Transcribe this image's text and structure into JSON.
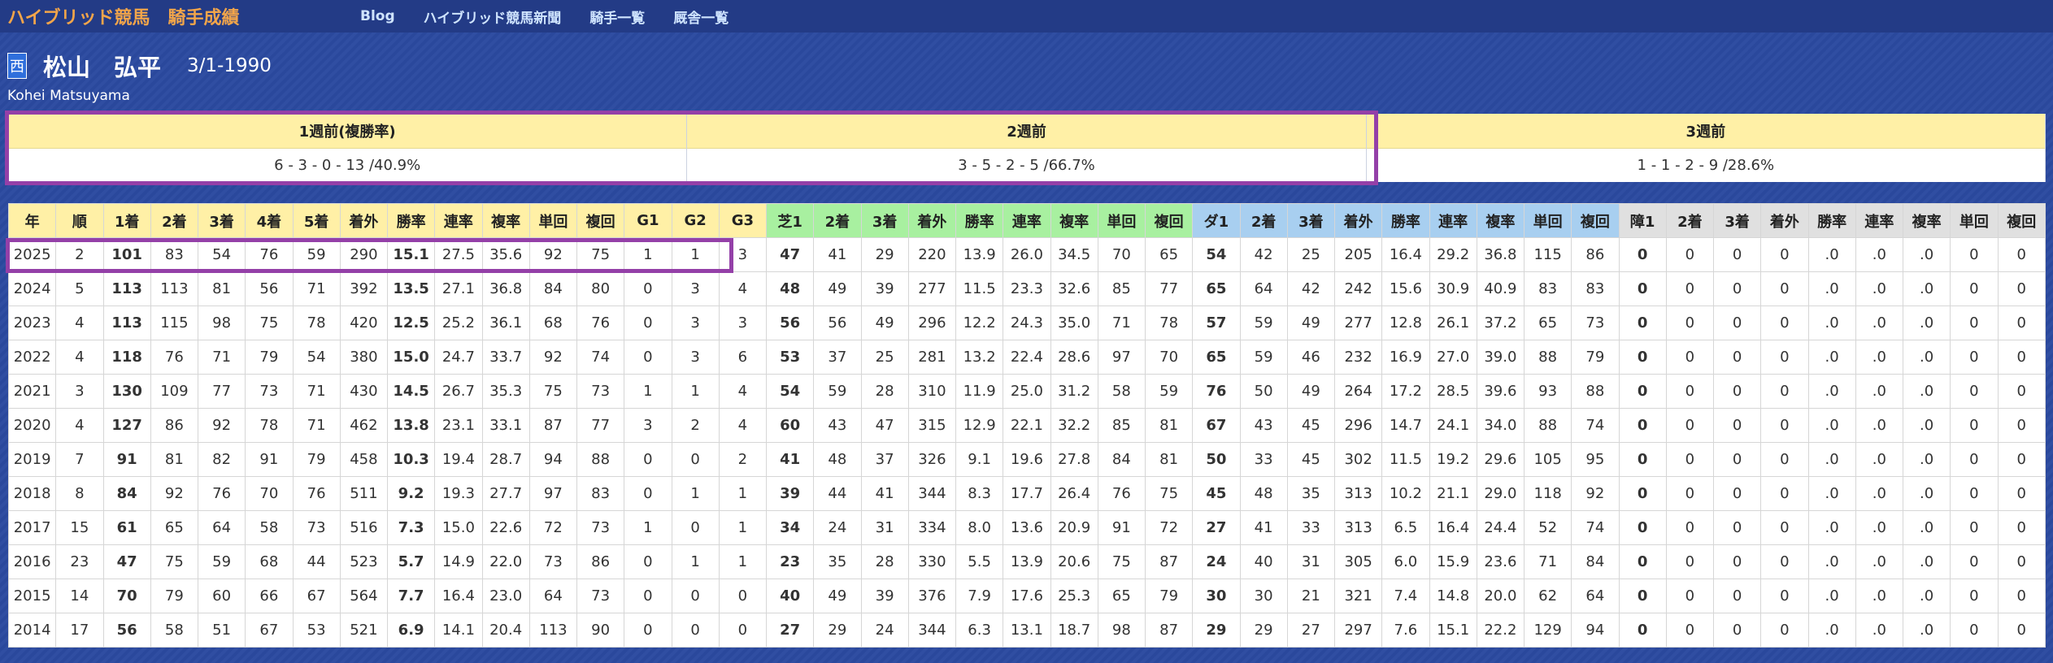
{
  "header": {
    "title": "ハイブリッド競馬　騎手成績",
    "nav": [
      {
        "label": "Blog"
      },
      {
        "label": "ハイブリッド競馬新聞"
      },
      {
        "label": "騎手一覧"
      },
      {
        "label": "厩舎一覧"
      }
    ]
  },
  "jockey": {
    "region_badge": "西",
    "name": "松山　弘平",
    "birth": "3/1-1990",
    "romaji": "Kohei Matsuyama"
  },
  "weeks": [
    {
      "label": "1週前(複勝率)",
      "value": "6 - 3 - 0 - 13 /40.9%"
    },
    {
      "label": "2週前",
      "value": "3 - 5 - 2 - 5 /66.7%"
    },
    {
      "label": "3週前",
      "value": "1 - 1 - 2 - 9 /28.6%"
    }
  ],
  "colors": {
    "background": "#2b4aa0",
    "brand": "#f2a54a",
    "highlight_border": "#9440a8",
    "overall_header": "#fff0a6",
    "turf_header": "#a8f0a0",
    "dirt_header": "#a8cff0",
    "steeple_header": "#e0e0e0"
  },
  "stats": {
    "columns": [
      {
        "label": "年",
        "group": "o"
      },
      {
        "label": "順",
        "group": "o"
      },
      {
        "label": "1着",
        "group": "o"
      },
      {
        "label": "2着",
        "group": "o"
      },
      {
        "label": "3着",
        "group": "o"
      },
      {
        "label": "4着",
        "group": "o"
      },
      {
        "label": "5着",
        "group": "o"
      },
      {
        "label": "着外",
        "group": "o"
      },
      {
        "label": "勝率",
        "group": "o"
      },
      {
        "label": "連率",
        "group": "o"
      },
      {
        "label": "複率",
        "group": "o"
      },
      {
        "label": "単回",
        "group": "o"
      },
      {
        "label": "複回",
        "group": "o"
      },
      {
        "label": "G1",
        "group": "o"
      },
      {
        "label": "G2",
        "group": "o"
      },
      {
        "label": "G3",
        "group": "o"
      },
      {
        "label": "芝1",
        "group": "t"
      },
      {
        "label": "2着",
        "group": "t"
      },
      {
        "label": "3着",
        "group": "t"
      },
      {
        "label": "着外",
        "group": "t"
      },
      {
        "label": "勝率",
        "group": "t"
      },
      {
        "label": "連率",
        "group": "t"
      },
      {
        "label": "複率",
        "group": "t"
      },
      {
        "label": "単回",
        "group": "t"
      },
      {
        "label": "複回",
        "group": "t"
      },
      {
        "label": "ダ1",
        "group": "d"
      },
      {
        "label": "2着",
        "group": "d"
      },
      {
        "label": "3着",
        "group": "d"
      },
      {
        "label": "着外",
        "group": "d"
      },
      {
        "label": "勝率",
        "group": "d"
      },
      {
        "label": "連率",
        "group": "d"
      },
      {
        "label": "複率",
        "group": "d"
      },
      {
        "label": "単回",
        "group": "d"
      },
      {
        "label": "複回",
        "group": "d"
      },
      {
        "label": "障1",
        "group": "s"
      },
      {
        "label": "2着",
        "group": "s"
      },
      {
        "label": "3着",
        "group": "s"
      },
      {
        "label": "着外",
        "group": "s"
      },
      {
        "label": "勝率",
        "group": "s"
      },
      {
        "label": "連率",
        "group": "s"
      },
      {
        "label": "複率",
        "group": "s"
      },
      {
        "label": "単回",
        "group": "s"
      },
      {
        "label": "複回",
        "group": "s"
      }
    ],
    "bold_columns": [
      2,
      8,
      16,
      25,
      34
    ],
    "rows": [
      [
        "2025",
        "2",
        "101",
        "83",
        "54",
        "76",
        "59",
        "290",
        "15.1",
        "27.5",
        "35.6",
        "92",
        "75",
        "1",
        "1",
        "3",
        "47",
        "41",
        "29",
        "220",
        "13.9",
        "26.0",
        "34.5",
        "70",
        "65",
        "54",
        "42",
        "25",
        "205",
        "16.4",
        "29.2",
        "36.8",
        "115",
        "86",
        "0",
        "0",
        "0",
        "0",
        ".0",
        ".0",
        ".0",
        "0",
        "0"
      ],
      [
        "2024",
        "5",
        "113",
        "113",
        "81",
        "56",
        "71",
        "392",
        "13.5",
        "27.1",
        "36.8",
        "84",
        "80",
        "0",
        "3",
        "4",
        "48",
        "49",
        "39",
        "277",
        "11.5",
        "23.3",
        "32.6",
        "85",
        "77",
        "65",
        "64",
        "42",
        "242",
        "15.6",
        "30.9",
        "40.9",
        "83",
        "83",
        "0",
        "0",
        "0",
        "0",
        ".0",
        ".0",
        ".0",
        "0",
        "0"
      ],
      [
        "2023",
        "4",
        "113",
        "115",
        "98",
        "75",
        "78",
        "420",
        "12.5",
        "25.2",
        "36.1",
        "68",
        "76",
        "0",
        "3",
        "3",
        "56",
        "56",
        "49",
        "296",
        "12.2",
        "24.3",
        "35.0",
        "71",
        "78",
        "57",
        "59",
        "49",
        "277",
        "12.8",
        "26.1",
        "37.2",
        "65",
        "73",
        "0",
        "0",
        "0",
        "0",
        ".0",
        ".0",
        ".0",
        "0",
        "0"
      ],
      [
        "2022",
        "4",
        "118",
        "76",
        "71",
        "79",
        "54",
        "380",
        "15.0",
        "24.7",
        "33.7",
        "92",
        "74",
        "0",
        "3",
        "6",
        "53",
        "37",
        "25",
        "281",
        "13.2",
        "22.4",
        "28.6",
        "97",
        "70",
        "65",
        "59",
        "46",
        "232",
        "16.9",
        "27.0",
        "39.0",
        "88",
        "79",
        "0",
        "0",
        "0",
        "0",
        ".0",
        ".0",
        ".0",
        "0",
        "0"
      ],
      [
        "2021",
        "3",
        "130",
        "109",
        "77",
        "73",
        "71",
        "430",
        "14.5",
        "26.7",
        "35.3",
        "75",
        "73",
        "1",
        "1",
        "4",
        "54",
        "59",
        "28",
        "310",
        "11.9",
        "25.0",
        "31.2",
        "58",
        "59",
        "76",
        "50",
        "49",
        "264",
        "17.2",
        "28.5",
        "39.6",
        "93",
        "88",
        "0",
        "0",
        "0",
        "0",
        ".0",
        ".0",
        ".0",
        "0",
        "0"
      ],
      [
        "2020",
        "4",
        "127",
        "86",
        "92",
        "78",
        "71",
        "462",
        "13.8",
        "23.1",
        "33.1",
        "87",
        "77",
        "3",
        "2",
        "4",
        "60",
        "43",
        "47",
        "315",
        "12.9",
        "22.1",
        "32.2",
        "85",
        "81",
        "67",
        "43",
        "45",
        "296",
        "14.7",
        "24.1",
        "34.0",
        "88",
        "74",
        "0",
        "0",
        "0",
        "0",
        ".0",
        ".0",
        ".0",
        "0",
        "0"
      ],
      [
        "2019",
        "7",
        "91",
        "81",
        "82",
        "91",
        "79",
        "458",
        "10.3",
        "19.4",
        "28.7",
        "94",
        "88",
        "0",
        "0",
        "2",
        "41",
        "48",
        "37",
        "326",
        "9.1",
        "19.6",
        "27.8",
        "84",
        "81",
        "50",
        "33",
        "45",
        "302",
        "11.5",
        "19.2",
        "29.6",
        "105",
        "95",
        "0",
        "0",
        "0",
        "0",
        ".0",
        ".0",
        ".0",
        "0",
        "0"
      ],
      [
        "2018",
        "8",
        "84",
        "92",
        "76",
        "70",
        "76",
        "511",
        "9.2",
        "19.3",
        "27.7",
        "97",
        "83",
        "0",
        "1",
        "1",
        "39",
        "44",
        "41",
        "344",
        "8.3",
        "17.7",
        "26.4",
        "76",
        "75",
        "45",
        "48",
        "35",
        "313",
        "10.2",
        "21.1",
        "29.0",
        "118",
        "92",
        "0",
        "0",
        "0",
        "0",
        ".0",
        ".0",
        ".0",
        "0",
        "0"
      ],
      [
        "2017",
        "15",
        "61",
        "65",
        "64",
        "58",
        "73",
        "516",
        "7.3",
        "15.0",
        "22.6",
        "72",
        "73",
        "1",
        "0",
        "1",
        "34",
        "24",
        "31",
        "334",
        "8.0",
        "13.6",
        "20.9",
        "91",
        "72",
        "27",
        "41",
        "33",
        "313",
        "6.5",
        "16.4",
        "24.4",
        "52",
        "74",
        "0",
        "0",
        "0",
        "0",
        ".0",
        ".0",
        ".0",
        "0",
        "0"
      ],
      [
        "2016",
        "23",
        "47",
        "75",
        "59",
        "68",
        "44",
        "523",
        "5.7",
        "14.9",
        "22.0",
        "73",
        "86",
        "0",
        "1",
        "1",
        "23",
        "35",
        "28",
        "330",
        "5.5",
        "13.9",
        "20.6",
        "75",
        "87",
        "24",
        "40",
        "31",
        "305",
        "6.0",
        "15.9",
        "23.6",
        "71",
        "84",
        "0",
        "0",
        "0",
        "0",
        ".0",
        ".0",
        ".0",
        "0",
        "0"
      ],
      [
        "2015",
        "14",
        "70",
        "79",
        "60",
        "66",
        "67",
        "564",
        "7.7",
        "16.4",
        "23.0",
        "64",
        "73",
        "0",
        "0",
        "0",
        "40",
        "49",
        "39",
        "376",
        "7.9",
        "17.6",
        "25.3",
        "65",
        "79",
        "30",
        "30",
        "21",
        "321",
        "7.4",
        "14.8",
        "20.0",
        "62",
        "64",
        "0",
        "0",
        "0",
        "0",
        ".0",
        ".0",
        ".0",
        "0",
        "0"
      ],
      [
        "2014",
        "17",
        "56",
        "58",
        "51",
        "67",
        "53",
        "521",
        "6.9",
        "14.1",
        "20.4",
        "113",
        "90",
        "0",
        "0",
        "0",
        "27",
        "29",
        "24",
        "344",
        "6.3",
        "13.1",
        "18.7",
        "98",
        "87",
        "29",
        "29",
        "27",
        "297",
        "7.6",
        "15.1",
        "22.2",
        "129",
        "94",
        "0",
        "0",
        "0",
        "0",
        ".0",
        ".0",
        ".0",
        "0",
        "0"
      ]
    ]
  }
}
